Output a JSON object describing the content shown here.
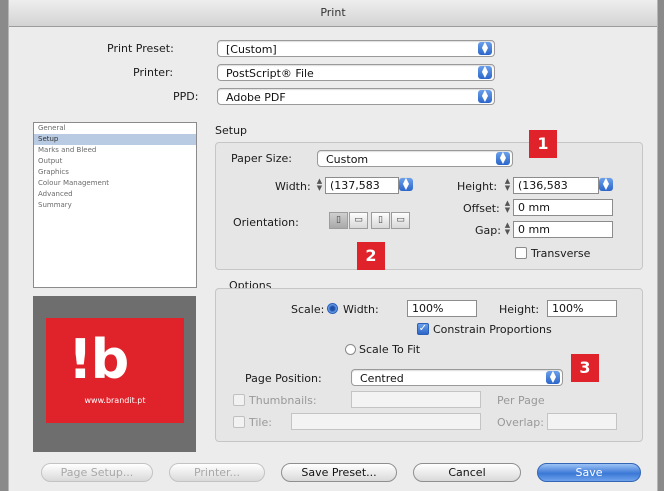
{
  "window": {
    "title": "Print"
  },
  "top": {
    "print_preset_label": "Print Preset:",
    "print_preset_value": "[Custom]",
    "printer_label": "Printer:",
    "printer_value": "PostScript® File",
    "ppd_label": "PPD:",
    "ppd_value": "Adobe PDF"
  },
  "sidebar": {
    "items": [
      "General",
      "Setup",
      "Marks and Bleed",
      "Output",
      "Graphics",
      "Colour Management",
      "Advanced",
      "Summary"
    ],
    "selected": "Setup"
  },
  "logo": {
    "mark": "!b",
    "url": "www.brandit.pt"
  },
  "setup": {
    "heading": "Setup",
    "paper_size_label": "Paper Size:",
    "paper_size_value": "Custom",
    "width_label": "Width:",
    "width_value": "(137,583",
    "height_label": "Height:",
    "height_value": "(136,583",
    "offset_label": "Offset:",
    "offset_value": "0 mm",
    "gap_label": "Gap:",
    "gap_value": "0 mm",
    "orientation_label": "Orientation:",
    "transverse_label": "Transverse"
  },
  "options": {
    "heading": "Options",
    "scale_label": "Scale:",
    "width_radio_label": "Width:",
    "width_scale_value": "100%",
    "height_scale_label": "Height:",
    "height_scale_value": "100%",
    "constrain_label": "Constrain Proportions",
    "scale_to_fit_label": "Scale To Fit",
    "page_position_label": "Page Position:",
    "page_position_value": "Centred",
    "thumbnails_label": "Thumbnails:",
    "per_page_label": "Per Page",
    "tile_label": "Tile:",
    "overlap_label": "Overlap:"
  },
  "annotations": {
    "one": "1",
    "two": "2",
    "three": "3"
  },
  "buttons": {
    "page_setup": "Page Setup...",
    "printer": "Printer...",
    "save_preset": "Save Preset...",
    "cancel": "Cancel",
    "save": "Save"
  },
  "colors": {
    "accent": "#2c66c9",
    "badge": "#e0232a"
  }
}
